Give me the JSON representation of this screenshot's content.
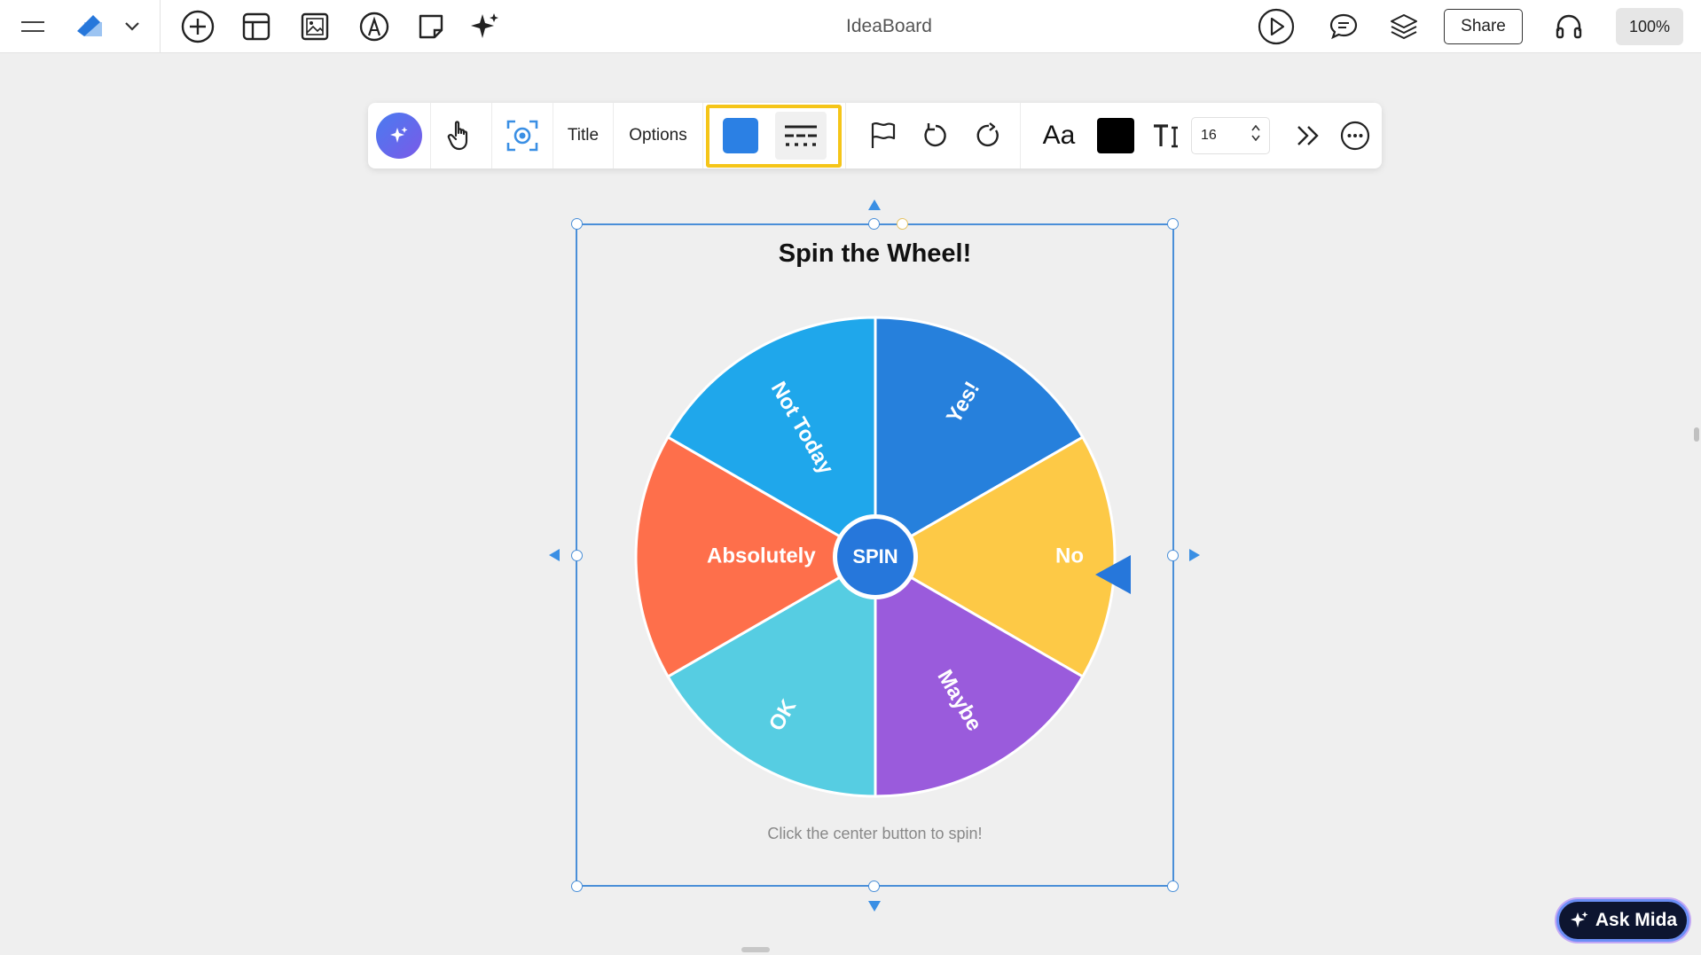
{
  "app": {
    "title": "IdeaBoard"
  },
  "topbar": {
    "left_icons": [
      "menu-icon",
      "board-logo-icon",
      "chevron-down-icon",
      "add-circle-icon",
      "template-icon",
      "image-icon",
      "pen-tool-icon",
      "sticky-note-icon",
      "sparkle-icon"
    ],
    "right_icons": [
      "play-icon",
      "comment-icon",
      "layers-icon",
      "headset-icon"
    ],
    "share_label": "Share",
    "zoom_label": "100%"
  },
  "toolbar": {
    "title_label": "Title",
    "options_label": "Options",
    "color": "#2b80e4",
    "text_color": "#000000",
    "font_label": "Aa",
    "font_size": "16",
    "icons": [
      "ai-sparkle-icon",
      "hand-pointer-icon",
      "focus-icon",
      "flag-icon",
      "undo-icon",
      "redo-icon",
      "text-size-icon",
      "double-chevron-right-icon",
      "more-icon"
    ]
  },
  "widget": {
    "title": "Spin the Wheel!",
    "hint": "Click the center button to spin!",
    "spin_label": "SPIN",
    "segments": [
      {
        "label": "Yes!",
        "color": "#2680dc"
      },
      {
        "label": "No",
        "color": "#fdc946"
      },
      {
        "label": "Maybe",
        "color": "#9a5bdc"
      },
      {
        "label": "OK",
        "color": "#56cde2"
      },
      {
        "label": "Absolutely",
        "color": "#fe6f4b"
      },
      {
        "label": "Not Today",
        "color": "#1fa7eb"
      }
    ]
  },
  "ask": {
    "label": "Ask Mida"
  }
}
